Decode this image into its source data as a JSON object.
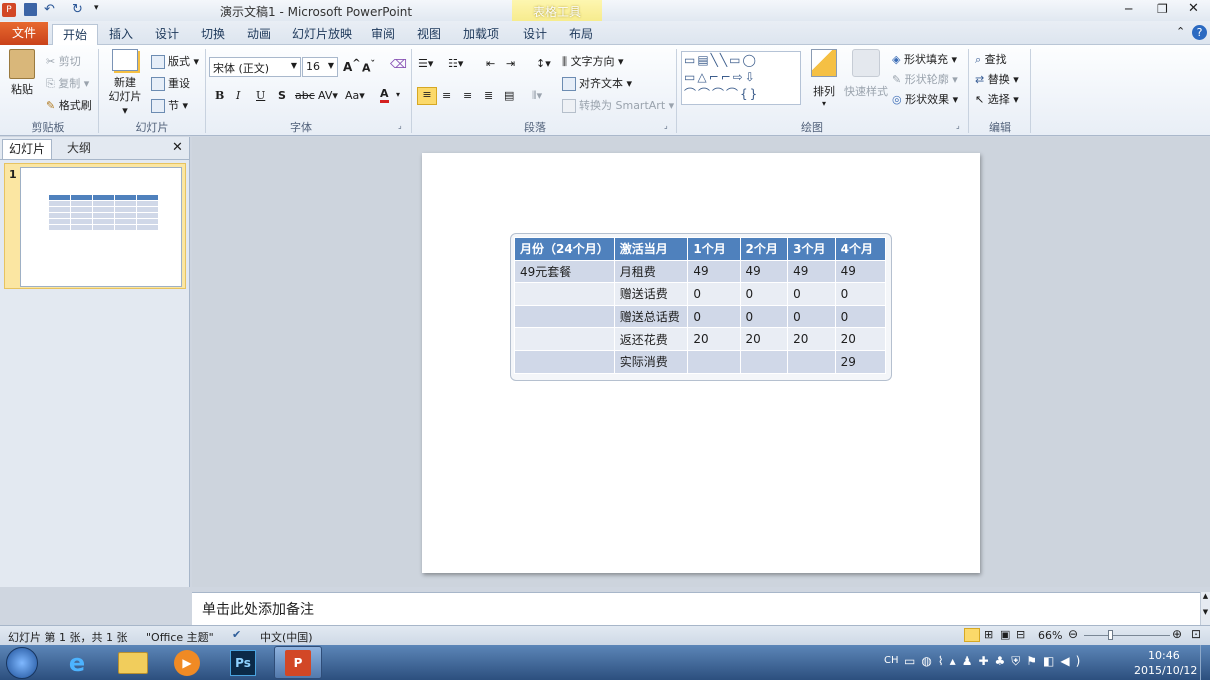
{
  "titlebar": {
    "title": "演示文稿1 - Microsoft PowerPoint",
    "context_tab": "表格工具"
  },
  "tabs": [
    "文件",
    "开始",
    "插入",
    "设计",
    "切换",
    "动画",
    "幻灯片放映",
    "审阅",
    "视图",
    "加载项",
    "设计",
    "布局"
  ],
  "clipboard": {
    "paste": "粘贴",
    "cut": "剪切",
    "copy": "复制",
    "format_painter": "格式刷",
    "label": "剪贴板"
  },
  "slides_group": {
    "new_slide": "新建\n幻灯片",
    "layout": "版式",
    "reset": "重设",
    "section": "节",
    "label": "幻灯片"
  },
  "font": {
    "name": "宋体 (正文)",
    "size": "16",
    "label": "字体"
  },
  "paragraph": {
    "text_direction": "文字方向",
    "align_text": "对齐文本",
    "smartart": "转换为 SmartArt",
    "label": "段落"
  },
  "drawing": {
    "arrange": "排列",
    "quick_styles": "快速样式",
    "shape_fill": "形状填充",
    "shape_outline": "形状轮廓",
    "shape_effects": "形状效果",
    "label": "绘图"
  },
  "editing": {
    "find": "查找",
    "replace": "替换",
    "select": "选择",
    "label": "编辑"
  },
  "leftpane": {
    "tab_slides": "幻灯片",
    "tab_outline": "大纲",
    "slide_number": "1"
  },
  "table": {
    "headers": [
      "月份（24个月）",
      "激活当月",
      "1个月",
      "2个月",
      "3个月",
      "4个月"
    ],
    "rows": [
      [
        "49元套餐",
        "月租费",
        "49",
        "49",
        "49",
        "49"
      ],
      [
        "",
        "赠送话费",
        "0",
        "0",
        "0",
        "0"
      ],
      [
        "",
        "赠送总话费",
        "0",
        "0",
        "0",
        "0"
      ],
      [
        "",
        "返还花费",
        "20",
        "20",
        "20",
        "20"
      ],
      [
        "",
        "实际消费",
        "",
        "",
        "",
        "29"
      ]
    ]
  },
  "notes": {
    "placeholder": "单击此处添加备注"
  },
  "status": {
    "slide_info": "幻灯片 第 1 张，共 1 张",
    "theme": "\"Office 主题\"",
    "language": "中文(中国)",
    "zoom": "66%"
  },
  "taskbar": {
    "ime": "CH",
    "time": "10:46",
    "date": "2015/10/12"
  }
}
